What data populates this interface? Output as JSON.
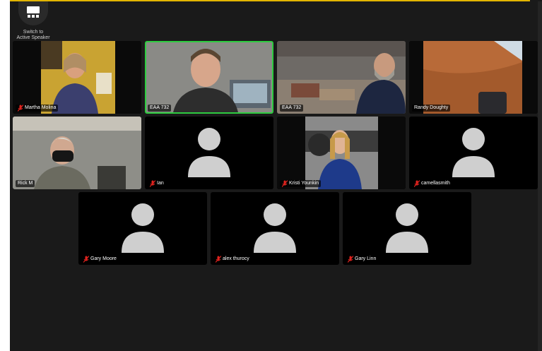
{
  "view_switch": {
    "label": "Switch to\nActive Speaker",
    "icon": "gallery-view-icon"
  },
  "colors": {
    "accent_top": "#e2b500",
    "active_speaker": "#2ecc40",
    "muted": "#e0231e"
  },
  "participants": [
    {
      "name": "Martha Molina",
      "muted": true,
      "video": true
    },
    {
      "name": "EAA 732",
      "muted": false,
      "video": true,
      "active": true
    },
    {
      "name": "EAA 732",
      "muted": false,
      "video": true
    },
    {
      "name": "Randy Doughty",
      "muted": false,
      "video": true
    },
    {
      "name": "Rick M",
      "muted": false,
      "video": true
    },
    {
      "name": "Ian",
      "muted": true,
      "video": false
    },
    {
      "name": "Kristi Younkin",
      "muted": true,
      "video": true
    },
    {
      "name": "camellasmith",
      "muted": true,
      "video": false
    },
    {
      "name": "Gary Moore",
      "muted": true,
      "video": false
    },
    {
      "name": "alex thurocy",
      "muted": true,
      "video": false
    },
    {
      "name": "Gary Linn",
      "muted": true,
      "video": false
    }
  ]
}
